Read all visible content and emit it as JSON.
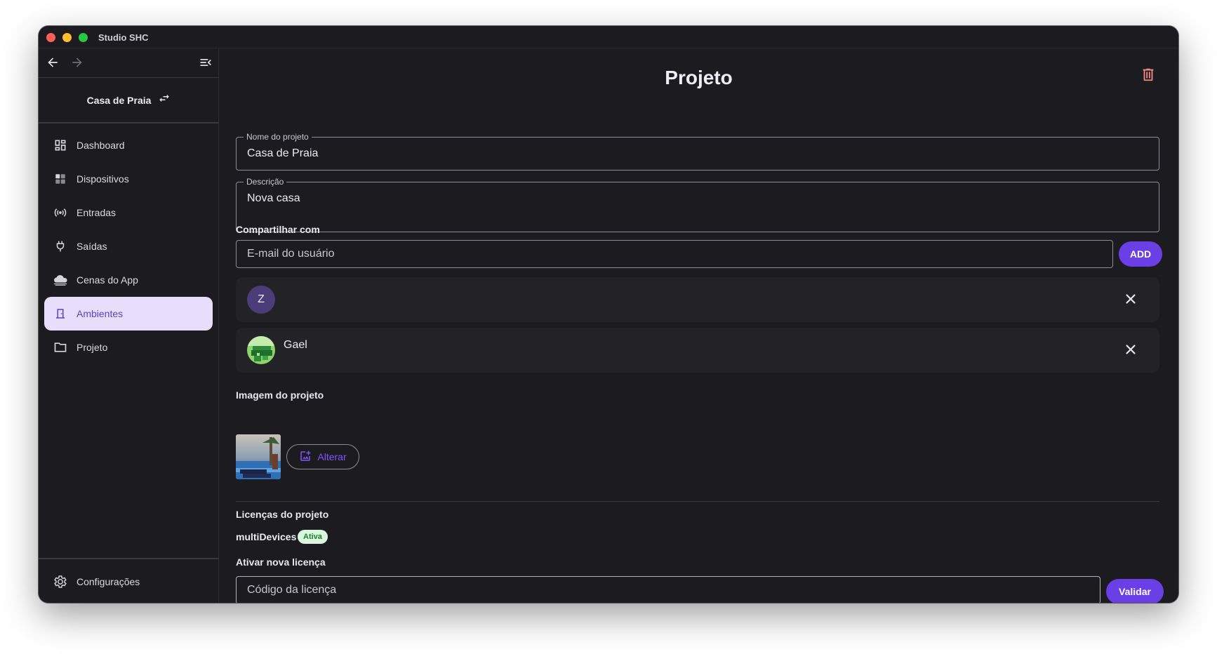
{
  "window": {
    "title": "Studio SHC"
  },
  "sidebar": {
    "project_name": "Casa de Praia",
    "items": [
      {
        "label": "Dashboard",
        "icon": "dashboard-icon"
      },
      {
        "label": "Dispositivos",
        "icon": "devices-icon"
      },
      {
        "label": "Entradas",
        "icon": "sensor-icon"
      },
      {
        "label": "Saídas",
        "icon": "plug-icon"
      },
      {
        "label": "Cenas do App",
        "icon": "cloud-icon"
      },
      {
        "label": "Ambientes",
        "icon": "door-icon",
        "active": true
      },
      {
        "label": "Projeto",
        "icon": "folder-icon"
      }
    ],
    "settings_label": "Configurações"
  },
  "main": {
    "title": "Projeto",
    "project_name_label": "Nome do projeto",
    "project_name_value": "Casa de Praia",
    "description_label": "Descrição",
    "description_value": "Nova casa",
    "share_label": "Compartilhar com",
    "email_placeholder": "E-mail do usuário",
    "add_label": "ADD",
    "shared_users": [
      {
        "initial": "Z",
        "name": ""
      },
      {
        "initial": "",
        "name": "Gael"
      }
    ],
    "image_label": "Imagem do projeto",
    "alter_label": "Alterar",
    "licenses_label": "Licenças do projeto",
    "license_name": "multiDevices",
    "license_status": "Ativa",
    "activate_label": "Ativar nova licença",
    "license_placeholder": "Código da licença",
    "validate_label": "Validar"
  },
  "colors": {
    "background": "#1c1b1f",
    "accent": "#6a3fe6",
    "active_item_bg": "#e8defb",
    "active_item_fg": "#5b3fd1",
    "danger": "#f28b82",
    "badge_bg": "#d9f7dd",
    "badge_fg": "#1d7b33"
  }
}
